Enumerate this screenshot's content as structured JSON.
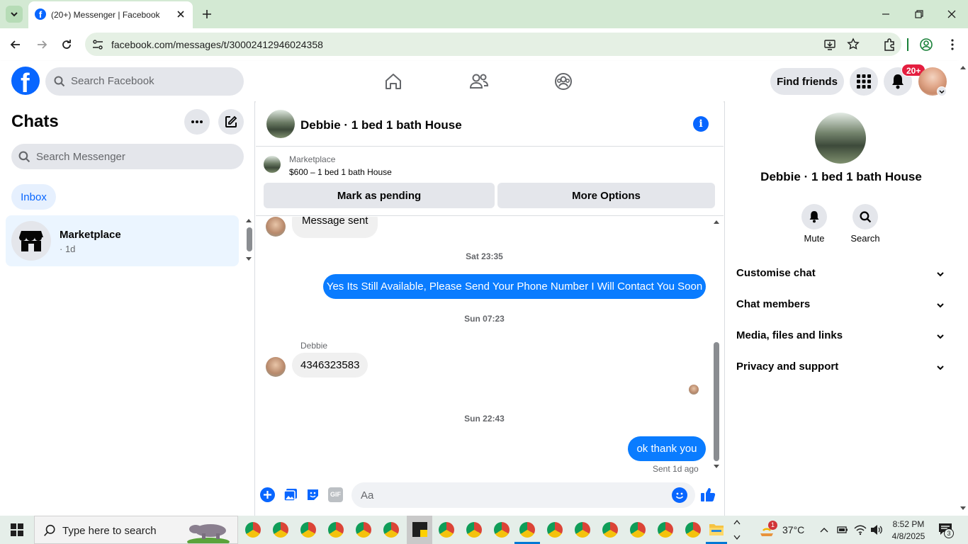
{
  "browser": {
    "tab_title": "(20+) Messenger | Facebook",
    "url": "facebook.com/messages/t/30002412946024358"
  },
  "header": {
    "search_placeholder": "Search Facebook",
    "find_friends": "Find friends",
    "notification_count": "20+"
  },
  "left": {
    "title": "Chats",
    "search_placeholder": "Search Messenger",
    "filter_inbox": "Inbox",
    "chats": [
      {
        "name": "Marketplace",
        "meta": "· 1d"
      }
    ]
  },
  "chat": {
    "title": "Debbie · 1 bed 1 bath House",
    "listing_source": "Marketplace",
    "listing_title": "$600 – 1 bed 1 bath House",
    "mark_pending": "Mark as pending",
    "more_options": "More Options",
    "messages": {
      "m1": "Message sent",
      "t1": "Sat 23:35",
      "m2": "Yes Its Still Available, Please Send Your Phone Number I Will Contact You Soon",
      "t2": "Sun 07:23",
      "sender": "Debbie",
      "m3": "4346323583",
      "t3": "Sun 22:43",
      "m4": "ok thank you",
      "status": "Sent 1d ago"
    },
    "composer_placeholder": "Aa"
  },
  "right": {
    "name": "Debbie · 1 bed 1 bath House",
    "mute": "Mute",
    "search": "Search",
    "sections": [
      "Customise chat",
      "Chat members",
      "Media, files and links",
      "Privacy and support"
    ]
  },
  "taskbar": {
    "search_placeholder": "Type here to search",
    "temperature": "37°C",
    "weather_badge": "1",
    "time": "8:52 PM",
    "date": "4/8/2025",
    "notif_count": "3"
  },
  "colors": {
    "brand_blue": "#0866ff",
    "bubble_blue": "#0a7cff",
    "notification_red": "#e41e3f",
    "chrome_green": "#d3e9d3"
  }
}
